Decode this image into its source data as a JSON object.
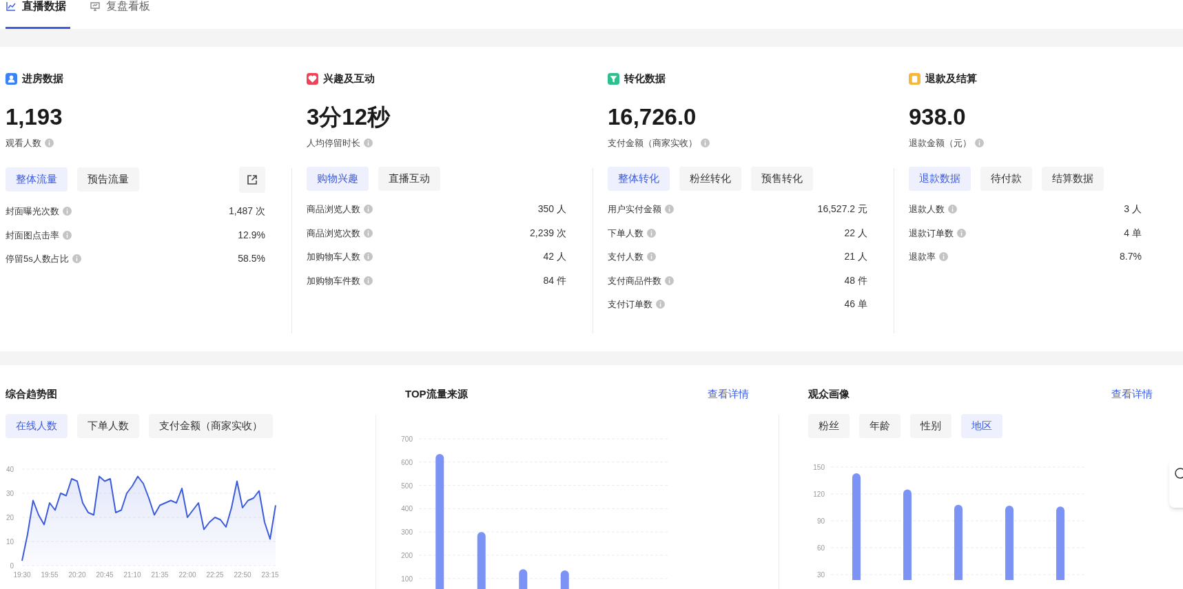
{
  "tabs": [
    {
      "label": "直播数据",
      "selected": true
    },
    {
      "label": "复盘看板",
      "selected": false
    }
  ],
  "overview": [
    {
      "title": "进房数据",
      "color": "#3b82f6",
      "value": "1,193",
      "value_label": "观看人数",
      "export_button": true,
      "filters": [
        {
          "label": "整体流量",
          "selected": true
        },
        {
          "label": "预告流量",
          "selected": false
        }
      ],
      "rows": [
        {
          "label": "封面曝光次数",
          "value": "1,487 次"
        },
        {
          "label": "封面图点击率",
          "value": "12.9%"
        },
        {
          "label": "停留5s人数占比",
          "value": "58.5%"
        }
      ]
    },
    {
      "title": "兴趣及互动",
      "color": "#ef4458",
      "value": "3分12秒",
      "value_label": "人均停留时长",
      "filters": [
        {
          "label": "购物兴趣",
          "selected": true
        },
        {
          "label": "直播互动",
          "selected": false
        }
      ],
      "rows": [
        {
          "label": "商品浏览人数",
          "value": "350 人"
        },
        {
          "label": "商品浏览次数",
          "value": "2,239 次"
        },
        {
          "label": "加购物车人数",
          "value": "42 人"
        },
        {
          "label": "加购物车件数",
          "value": "84 件"
        }
      ]
    },
    {
      "title": "转化数据",
      "color": "#2fbf8f",
      "value": "16,726.0",
      "value_label": "支付金额（商家实收）",
      "filters": [
        {
          "label": "整体转化",
          "selected": true
        },
        {
          "label": "粉丝转化",
          "selected": false
        },
        {
          "label": "预售转化",
          "selected": false
        }
      ],
      "rows": [
        {
          "label": "用户实付金额",
          "value": "16,527.2 元"
        },
        {
          "label": "下单人数",
          "value": "22 人"
        },
        {
          "label": "支付人数",
          "value": "21 人"
        },
        {
          "label": "支付商品件数",
          "value": "48 件"
        },
        {
          "label": "支付订单数",
          "value": "46 单"
        }
      ]
    },
    {
      "title": "退款及结算",
      "color": "#f5b83d",
      "value": "938.0",
      "value_label": "退款金额（元）",
      "filters": [
        {
          "label": "退款数据",
          "selected": true
        },
        {
          "label": "待付款",
          "selected": false
        },
        {
          "label": "结算数据",
          "selected": false
        }
      ],
      "rows": [
        {
          "label": "退款人数",
          "value": "3 人"
        },
        {
          "label": "退款订单数",
          "value": "4 单"
        },
        {
          "label": "退款率",
          "value": "8.7%"
        }
      ]
    }
  ],
  "trend": {
    "title": "综合趋势图",
    "filters": [
      {
        "label": "在线人数",
        "selected": true
      },
      {
        "label": "下单人数",
        "selected": false
      },
      {
        "label": "支付金额（商家实收）",
        "selected": false
      }
    ],
    "chart_data": {
      "type": "area",
      "grid": true,
      "ylim": [
        0,
        40
      ],
      "yticks": [
        0,
        10,
        20,
        30,
        40
      ],
      "categories": [
        "19:30",
        null,
        null,
        null,
        null,
        "19:55",
        null,
        null,
        null,
        null,
        "20:20",
        null,
        null,
        null,
        null,
        "20:45",
        null,
        null,
        null,
        null,
        "21:10",
        null,
        null,
        null,
        null,
        "21:35",
        null,
        null,
        null,
        null,
        "22:00",
        null,
        null,
        null,
        null,
        "22:25",
        null,
        null,
        null,
        null,
        "22:50",
        null,
        null,
        null,
        null,
        "23:15",
        null
      ],
      "values": [
        2,
        13,
        27,
        21,
        17,
        26,
        23,
        30,
        29,
        36,
        35,
        26,
        22,
        21,
        37,
        35,
        36,
        22,
        23,
        30,
        33,
        37,
        34,
        28,
        21,
        25,
        26,
        27,
        26,
        32,
        20,
        23,
        26,
        15,
        18,
        20,
        19,
        16,
        24,
        35,
        24,
        27,
        28,
        31,
        18,
        11,
        25
      ]
    }
  },
  "traffic": {
    "title": "TOP流量来源",
    "link": "查看详情",
    "chart_data": {
      "type": "bar",
      "grid": true,
      "ylim": [
        55,
        700
      ],
      "yticks": [
        100,
        200,
        300,
        400,
        500,
        600,
        700
      ],
      "values": [
        635,
        300,
        140,
        135,
        null,
        null
      ]
    }
  },
  "audience": {
    "title": "观众画像",
    "link": "查看详情",
    "filters": [
      {
        "label": "粉丝",
        "selected": false
      },
      {
        "label": "年龄",
        "selected": false
      },
      {
        "label": "性别",
        "selected": false
      },
      {
        "label": "地区",
        "selected": true
      }
    ],
    "chart_data": {
      "type": "bar",
      "grid": true,
      "ylim": [
        24,
        150
      ],
      "yticks": [
        30,
        60,
        90,
        120,
        150
      ],
      "values": [
        143,
        125,
        108,
        107,
        106
      ]
    }
  }
}
